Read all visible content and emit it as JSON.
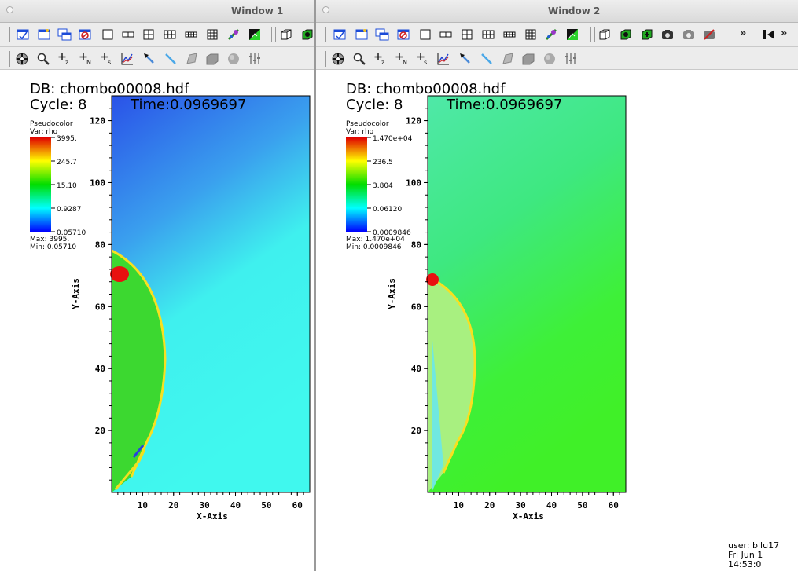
{
  "windows": [
    {
      "id": "win1",
      "title": "Window 1",
      "db": "DB: chombo00008.hdf",
      "cycle": "Cycle: 8",
      "time": "Time:0.0969697",
      "legend": {
        "plot_type": "Pseudocolor",
        "var": "Var: rho",
        "ticks": [
          "3995.",
          "245.7",
          "15.10",
          "0.9287",
          "0.05710"
        ],
        "max": "Max:  3995.",
        "min": "Min:  0.05710"
      },
      "x_axis_label": "X-Axis",
      "y_axis_label": "Y-Axis",
      "x_ticks": [
        "10",
        "20",
        "30",
        "40",
        "50",
        "60"
      ],
      "y_ticks": [
        "20",
        "40",
        "60",
        "80",
        "100",
        "120"
      ]
    },
    {
      "id": "win2",
      "title": "Window 2",
      "db": "DB: chombo00008.hdf",
      "cycle": "Cycle: 8",
      "time": "Time:0.0969697",
      "legend": {
        "plot_type": "Pseudocolor",
        "var": "Var: rho",
        "ticks": [
          "1.470e+04",
          "236.5",
          "3.804",
          "0.06120",
          "0.0009846"
        ],
        "max": "Max:  1.470e+04",
        "min": "Min:  0.0009846"
      },
      "x_axis_label": "X-Axis",
      "y_axis_label": "Y-Axis",
      "x_ticks": [
        "10",
        "20",
        "30",
        "40",
        "50",
        "60"
      ],
      "y_ticks": [
        "20",
        "40",
        "60",
        "80",
        "100",
        "120"
      ],
      "user_info": {
        "user": "user: bllu17",
        "date": "Fri Jun  1 14:53:0"
      }
    }
  ],
  "toolbar_icons_row1": [
    "new-window-icon",
    "clear-icon",
    "copy-icon",
    "delete-window-icon",
    "layout-1x1-icon",
    "layout-1x2-icon",
    "layout-2x2-icon",
    "layout-2x3-icon",
    "layout-2x4-icon",
    "layout-3x3-icon",
    "lock-view-icon",
    "invert-icon",
    "box-3d-icon",
    "reset-view-icon",
    "recenter-icon",
    "undo-view-icon",
    "camera-icon",
    "spin-icon",
    "lock-tools-icon"
  ],
  "toolbar_icons_row2": [
    "navigate-icon",
    "zoom-icon",
    "zone-pick-icon",
    "node-pick-icon",
    "spreadsheet-pick-icon",
    "lineout-icon",
    "point-tool-icon",
    "line-tool-icon",
    "plane-tool-icon",
    "box-tool-icon",
    "sphere-tool-icon",
    "axis-restrict-icon"
  ],
  "colors": {
    "accent": "#1b4bd8"
  }
}
